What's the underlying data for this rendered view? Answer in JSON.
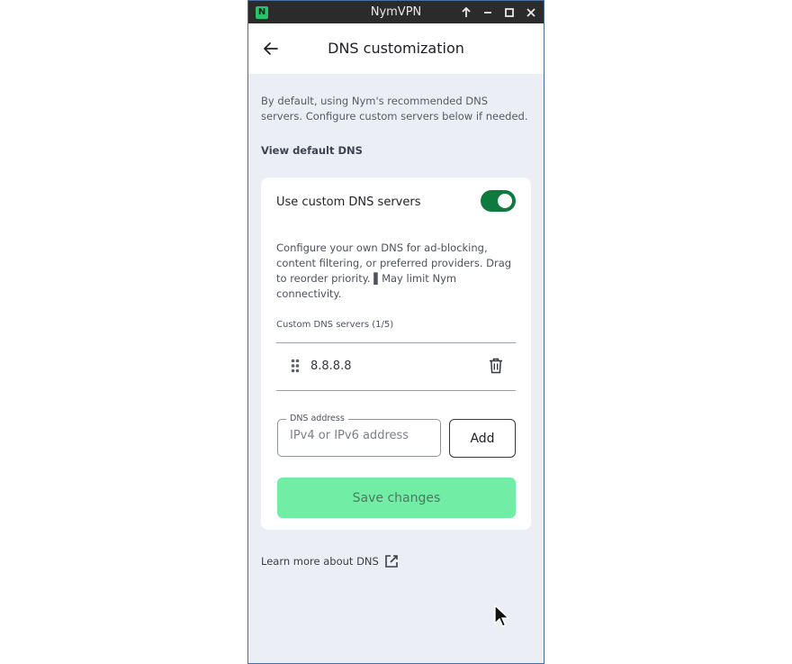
{
  "window": {
    "title": "NymVPN",
    "app_icon_letter": "N",
    "accent": "#27c26b"
  },
  "header": {
    "title": "DNS customization",
    "back_icon": "arrow-left-icon"
  },
  "intro": {
    "text": "By default, using Nym's recommended DNS servers. Configure custom servers below if needed.",
    "view_default_link": "View default DNS"
  },
  "card": {
    "toggle_label": "Use custom DNS servers",
    "toggle_on": true,
    "toggle_color": "#0f7a3e",
    "description": "Configure your own DNS for ad-blocking, content filtering, or preferred providers. Drag to reorder priority. ▌May limit Nym connectivity.",
    "list_header": "Custom DNS servers (1/5)",
    "servers": [
      {
        "address": "8.8.8.8"
      }
    ],
    "input": {
      "label": "DNS address",
      "placeholder": "IPv4 or IPv6 address",
      "value": ""
    },
    "add_label": "Add",
    "save_label": "Save changes",
    "save_color": "#72eda6"
  },
  "footer": {
    "learn_more": "Learn more about DNS",
    "external_icon": "external-link-icon"
  }
}
